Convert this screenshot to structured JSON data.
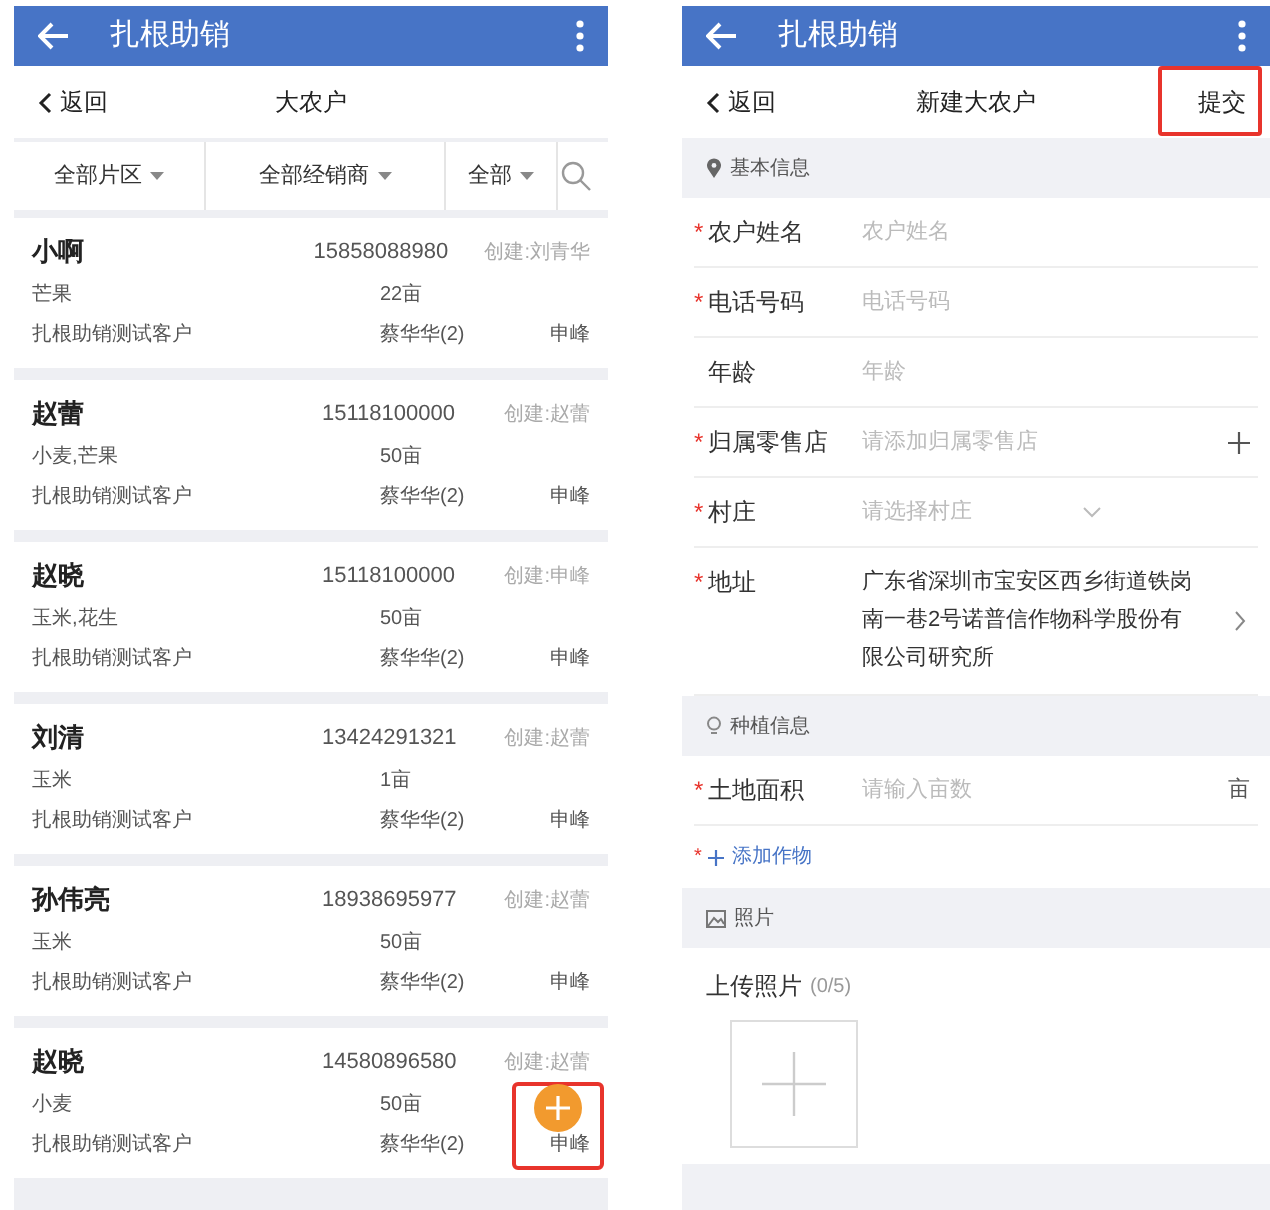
{
  "left": {
    "app_bar": {
      "title": "扎根助销"
    },
    "nav": {
      "back": "返回",
      "title": "大农户"
    },
    "filters": [
      "全部片区",
      "全部经销商",
      "全部"
    ],
    "farmers": [
      {
        "name": "小啊",
        "phone": "15858088980",
        "creator": "创建:刘青华",
        "crops": "芒果",
        "area": "22亩",
        "customer": "扎根助销测试客户",
        "dealer": "蔡华华(2)",
        "staff": "申峰"
      },
      {
        "name": "赵蕾",
        "phone": "15118100000",
        "creator": "创建:赵蕾",
        "crops": "小麦,芒果",
        "area": "50亩",
        "customer": "扎根助销测试客户",
        "dealer": "蔡华华(2)",
        "staff": "申峰"
      },
      {
        "name": "赵晓",
        "phone": "15118100000",
        "creator": "创建:申峰",
        "crops": "玉米,花生",
        "area": "50亩",
        "customer": "扎根助销测试客户",
        "dealer": "蔡华华(2)",
        "staff": "申峰"
      },
      {
        "name": "刘清",
        "phone": "13424291321",
        "creator": "创建:赵蕾",
        "crops": "玉米",
        "area": "1亩",
        "customer": "扎根助销测试客户",
        "dealer": "蔡华华(2)",
        "staff": "申峰"
      },
      {
        "name": "孙伟亮",
        "phone": "18938695977",
        "creator": "创建:赵蕾",
        "crops": "玉米",
        "area": "50亩",
        "customer": "扎根助销测试客户",
        "dealer": "蔡华华(2)",
        "staff": "申峰"
      },
      {
        "name": "赵晓",
        "phone": "14580896580",
        "creator": "创建:赵蕾",
        "crops": "小麦",
        "area": "50亩",
        "customer": "扎根助销测试客户",
        "dealer": "蔡华华(2)",
        "staff": "申峰"
      }
    ],
    "fab": {
      "highlighted": true
    }
  },
  "right": {
    "app_bar": {
      "title": "扎根助销"
    },
    "required_mark": "*",
    "nav": {
      "back": "返回",
      "title": "新建大农户",
      "submit": "提交",
      "submit_highlighted": true
    },
    "sections": [
      {
        "kind": "header",
        "title": "基本信息"
      },
      {
        "kind": "field",
        "label": "农户姓名",
        "required": true,
        "placeholder": "农户姓名"
      },
      {
        "kind": "field",
        "label": "电话号码",
        "required": true,
        "placeholder": "电话号码"
      },
      {
        "kind": "field",
        "label": "年龄",
        "required": false,
        "placeholder": "年龄"
      },
      {
        "kind": "add",
        "label": "归属零售店",
        "required": true,
        "placeholder": "请添加归属零售店"
      },
      {
        "kind": "select",
        "label": "村庄",
        "required": true,
        "placeholder": "请选择村庄"
      },
      {
        "kind": "address",
        "label": "地址",
        "required": true,
        "value": "广东省深圳市宝安区西乡街道铁岗南一巷2号诺普信作物科学股份有限公司研究所"
      },
      {
        "kind": "header",
        "title": "种植信息"
      },
      {
        "kind": "unit",
        "label": "土地面积",
        "required": true,
        "placeholder": "请输入亩数",
        "unit": "亩"
      },
      {
        "kind": "link",
        "label": "添加作物",
        "required": true
      },
      {
        "kind": "header",
        "title": "照片"
      },
      {
        "kind": "upload",
        "label": "上传照片",
        "count": "(0/5)"
      }
    ]
  }
}
